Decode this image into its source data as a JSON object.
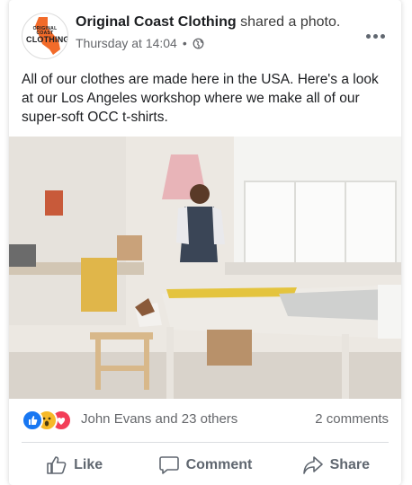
{
  "post": {
    "page_name": "Original Coast Clothing",
    "action": "shared a photo.",
    "timestamp": "Thursday at 14:04",
    "separator": "•",
    "text": "All of our clothes are made here in the USA. Here's a look at our Los Angeles workshop where we make all of our super-soft OCC t-shirts.",
    "logo": {
      "line1": "ORIGINAL COAST",
      "line2": "CLOTHING"
    }
  },
  "reactions": {
    "icons": [
      "like-icon",
      "wow-icon",
      "love-icon"
    ],
    "names": "John Evans and 23 others",
    "comments": "2 comments"
  },
  "actions": {
    "like": "Like",
    "comment": "Comment",
    "share": "Share"
  },
  "colors": {
    "like_blue": "#1877f2",
    "wow_yellow": "#f7b928",
    "love_red": "#f33e58",
    "logo_orange": "#f26b2a"
  }
}
